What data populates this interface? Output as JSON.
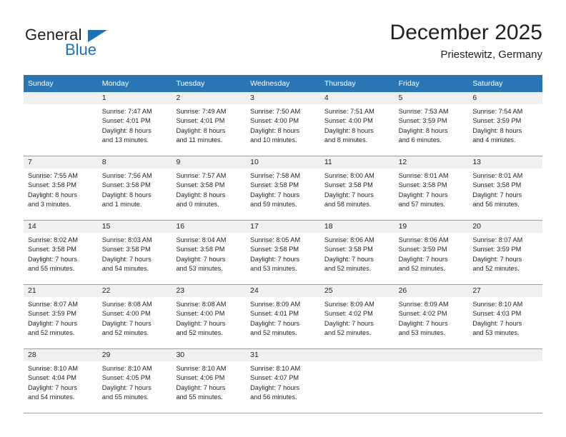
{
  "logo": {
    "word_one": "General",
    "word_two": "Blue",
    "triangle_icon": "triangle-icon",
    "brand_color": "#1b72b8"
  },
  "header": {
    "title": "December 2025",
    "subtitle": "Priestewitz, Germany"
  },
  "calendar": {
    "header_bg": "#2b77b5",
    "daynum_bg": "#f0f0f0",
    "weekdays": [
      "Sunday",
      "Monday",
      "Tuesday",
      "Wednesday",
      "Thursday",
      "Friday",
      "Saturday"
    ],
    "weeks": [
      [
        {
          "day": "",
          "sunrise": "",
          "sunset": "",
          "daylight_line1": "",
          "daylight_line2": ""
        },
        {
          "day": "1",
          "sunrise": "Sunrise: 7:47 AM",
          "sunset": "Sunset: 4:01 PM",
          "daylight_line1": "Daylight: 8 hours",
          "daylight_line2": "and 13 minutes."
        },
        {
          "day": "2",
          "sunrise": "Sunrise: 7:49 AM",
          "sunset": "Sunset: 4:01 PM",
          "daylight_line1": "Daylight: 8 hours",
          "daylight_line2": "and 11 minutes."
        },
        {
          "day": "3",
          "sunrise": "Sunrise: 7:50 AM",
          "sunset": "Sunset: 4:00 PM",
          "daylight_line1": "Daylight: 8 hours",
          "daylight_line2": "and 10 minutes."
        },
        {
          "day": "4",
          "sunrise": "Sunrise: 7:51 AM",
          "sunset": "Sunset: 4:00 PM",
          "daylight_line1": "Daylight: 8 hours",
          "daylight_line2": "and 8 minutes."
        },
        {
          "day": "5",
          "sunrise": "Sunrise: 7:53 AM",
          "sunset": "Sunset: 3:59 PM",
          "daylight_line1": "Daylight: 8 hours",
          "daylight_line2": "and 6 minutes."
        },
        {
          "day": "6",
          "sunrise": "Sunrise: 7:54 AM",
          "sunset": "Sunset: 3:59 PM",
          "daylight_line1": "Daylight: 8 hours",
          "daylight_line2": "and 4 minutes."
        }
      ],
      [
        {
          "day": "7",
          "sunrise": "Sunrise: 7:55 AM",
          "sunset": "Sunset: 3:58 PM",
          "daylight_line1": "Daylight: 8 hours",
          "daylight_line2": "and 3 minutes."
        },
        {
          "day": "8",
          "sunrise": "Sunrise: 7:56 AM",
          "sunset": "Sunset: 3:58 PM",
          "daylight_line1": "Daylight: 8 hours",
          "daylight_line2": "and 1 minute."
        },
        {
          "day": "9",
          "sunrise": "Sunrise: 7:57 AM",
          "sunset": "Sunset: 3:58 PM",
          "daylight_line1": "Daylight: 8 hours",
          "daylight_line2": "and 0 minutes."
        },
        {
          "day": "10",
          "sunrise": "Sunrise: 7:58 AM",
          "sunset": "Sunset: 3:58 PM",
          "daylight_line1": "Daylight: 7 hours",
          "daylight_line2": "and 59 minutes."
        },
        {
          "day": "11",
          "sunrise": "Sunrise: 8:00 AM",
          "sunset": "Sunset: 3:58 PM",
          "daylight_line1": "Daylight: 7 hours",
          "daylight_line2": "and 58 minutes."
        },
        {
          "day": "12",
          "sunrise": "Sunrise: 8:01 AM",
          "sunset": "Sunset: 3:58 PM",
          "daylight_line1": "Daylight: 7 hours",
          "daylight_line2": "and 57 minutes."
        },
        {
          "day": "13",
          "sunrise": "Sunrise: 8:01 AM",
          "sunset": "Sunset: 3:58 PM",
          "daylight_line1": "Daylight: 7 hours",
          "daylight_line2": "and 56 minutes."
        }
      ],
      [
        {
          "day": "14",
          "sunrise": "Sunrise: 8:02 AM",
          "sunset": "Sunset: 3:58 PM",
          "daylight_line1": "Daylight: 7 hours",
          "daylight_line2": "and 55 minutes."
        },
        {
          "day": "15",
          "sunrise": "Sunrise: 8:03 AM",
          "sunset": "Sunset: 3:58 PM",
          "daylight_line1": "Daylight: 7 hours",
          "daylight_line2": "and 54 minutes."
        },
        {
          "day": "16",
          "sunrise": "Sunrise: 8:04 AM",
          "sunset": "Sunset: 3:58 PM",
          "daylight_line1": "Daylight: 7 hours",
          "daylight_line2": "and 53 minutes."
        },
        {
          "day": "17",
          "sunrise": "Sunrise: 8:05 AM",
          "sunset": "Sunset: 3:58 PM",
          "daylight_line1": "Daylight: 7 hours",
          "daylight_line2": "and 53 minutes."
        },
        {
          "day": "18",
          "sunrise": "Sunrise: 8:06 AM",
          "sunset": "Sunset: 3:58 PM",
          "daylight_line1": "Daylight: 7 hours",
          "daylight_line2": "and 52 minutes."
        },
        {
          "day": "19",
          "sunrise": "Sunrise: 8:06 AM",
          "sunset": "Sunset: 3:59 PM",
          "daylight_line1": "Daylight: 7 hours",
          "daylight_line2": "and 52 minutes."
        },
        {
          "day": "20",
          "sunrise": "Sunrise: 8:07 AM",
          "sunset": "Sunset: 3:59 PM",
          "daylight_line1": "Daylight: 7 hours",
          "daylight_line2": "and 52 minutes."
        }
      ],
      [
        {
          "day": "21",
          "sunrise": "Sunrise: 8:07 AM",
          "sunset": "Sunset: 3:59 PM",
          "daylight_line1": "Daylight: 7 hours",
          "daylight_line2": "and 52 minutes."
        },
        {
          "day": "22",
          "sunrise": "Sunrise: 8:08 AM",
          "sunset": "Sunset: 4:00 PM",
          "daylight_line1": "Daylight: 7 hours",
          "daylight_line2": "and 52 minutes."
        },
        {
          "day": "23",
          "sunrise": "Sunrise: 8:08 AM",
          "sunset": "Sunset: 4:00 PM",
          "daylight_line1": "Daylight: 7 hours",
          "daylight_line2": "and 52 minutes."
        },
        {
          "day": "24",
          "sunrise": "Sunrise: 8:09 AM",
          "sunset": "Sunset: 4:01 PM",
          "daylight_line1": "Daylight: 7 hours",
          "daylight_line2": "and 52 minutes."
        },
        {
          "day": "25",
          "sunrise": "Sunrise: 8:09 AM",
          "sunset": "Sunset: 4:02 PM",
          "daylight_line1": "Daylight: 7 hours",
          "daylight_line2": "and 52 minutes."
        },
        {
          "day": "26",
          "sunrise": "Sunrise: 8:09 AM",
          "sunset": "Sunset: 4:02 PM",
          "daylight_line1": "Daylight: 7 hours",
          "daylight_line2": "and 53 minutes."
        },
        {
          "day": "27",
          "sunrise": "Sunrise: 8:10 AM",
          "sunset": "Sunset: 4:03 PM",
          "daylight_line1": "Daylight: 7 hours",
          "daylight_line2": "and 53 minutes."
        }
      ],
      [
        {
          "day": "28",
          "sunrise": "Sunrise: 8:10 AM",
          "sunset": "Sunset: 4:04 PM",
          "daylight_line1": "Daylight: 7 hours",
          "daylight_line2": "and 54 minutes."
        },
        {
          "day": "29",
          "sunrise": "Sunrise: 8:10 AM",
          "sunset": "Sunset: 4:05 PM",
          "daylight_line1": "Daylight: 7 hours",
          "daylight_line2": "and 55 minutes."
        },
        {
          "day": "30",
          "sunrise": "Sunrise: 8:10 AM",
          "sunset": "Sunset: 4:06 PM",
          "daylight_line1": "Daylight: 7 hours",
          "daylight_line2": "and 55 minutes."
        },
        {
          "day": "31",
          "sunrise": "Sunrise: 8:10 AM",
          "sunset": "Sunset: 4:07 PM",
          "daylight_line1": "Daylight: 7 hours",
          "daylight_line2": "and 56 minutes."
        },
        {
          "day": "",
          "sunrise": "",
          "sunset": "",
          "daylight_line1": "",
          "daylight_line2": ""
        },
        {
          "day": "",
          "sunrise": "",
          "sunset": "",
          "daylight_line1": "",
          "daylight_line2": ""
        },
        {
          "day": "",
          "sunrise": "",
          "sunset": "",
          "daylight_line1": "",
          "daylight_line2": ""
        }
      ]
    ]
  }
}
